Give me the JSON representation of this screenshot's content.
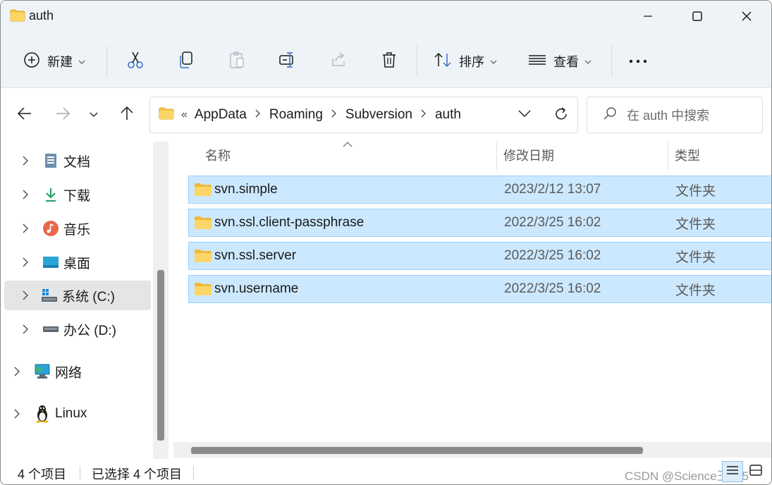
{
  "window": {
    "title": "auth"
  },
  "toolbar": {
    "new_label": "新建",
    "sort_label": "排序",
    "view_label": "查看"
  },
  "address": {
    "overflow": "«",
    "crumbs": [
      "AppData",
      "Roaming",
      "Subversion",
      "auth"
    ]
  },
  "search": {
    "placeholder": "在 auth 中搜索"
  },
  "sidebar": {
    "items": [
      {
        "label": "文档",
        "icon": "documents-icon"
      },
      {
        "label": "下载",
        "icon": "downloads-icon"
      },
      {
        "label": "音乐",
        "icon": "music-icon"
      },
      {
        "label": "桌面",
        "icon": "desktop-icon"
      },
      {
        "label": "系统 (C:)",
        "icon": "system-drive-icon",
        "selected": true
      },
      {
        "label": "办公 (D:)",
        "icon": "drive-icon"
      },
      {
        "label": "网络",
        "icon": "network-icon"
      },
      {
        "label": "Linux",
        "icon": "linux-icon"
      }
    ]
  },
  "columns": {
    "name": "名称",
    "modified": "修改日期",
    "type": "类型"
  },
  "files": [
    {
      "name": "svn.simple",
      "modified": "2023/2/12 13:07",
      "type": "文件夹"
    },
    {
      "name": "svn.ssl.client-passphrase",
      "modified": "2022/3/25 16:02",
      "type": "文件夹"
    },
    {
      "name": "svn.ssl.server",
      "modified": "2022/3/25 16:02",
      "type": "文件夹"
    },
    {
      "name": "svn.username",
      "modified": "2022/3/25 16:02",
      "type": "文件夹"
    }
  ],
  "status": {
    "count": "4 个项目",
    "selected": "已选择 4 个项目"
  },
  "watermark": "CSDN @Science王125",
  "colors": {
    "selection": "#cce8ff",
    "selection_border": "#99d1ff",
    "folder": "#f7c948",
    "header_bg": "#eef3f8"
  }
}
